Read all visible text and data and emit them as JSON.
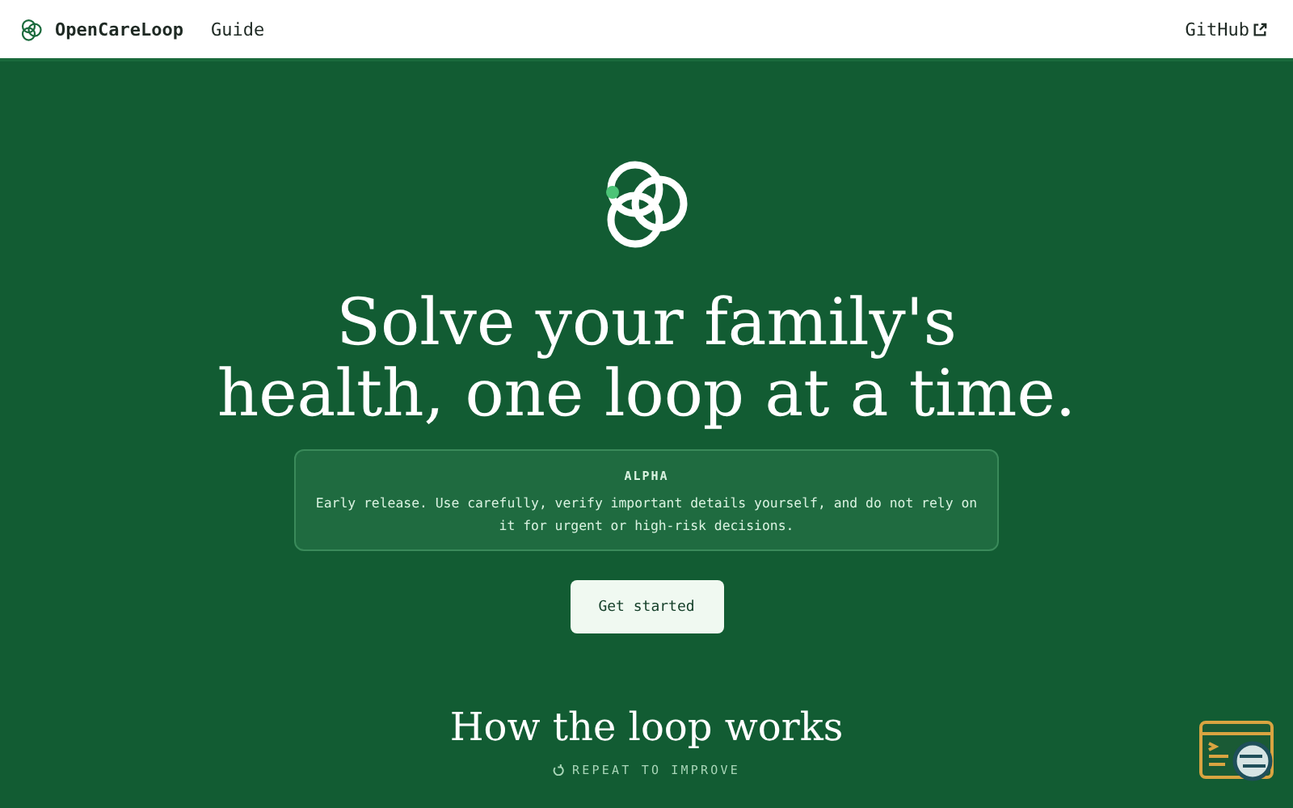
{
  "header": {
    "brand": "OpenCareLoop",
    "nav": [
      {
        "label": "Guide"
      }
    ],
    "github": "GitHub"
  },
  "hero": {
    "headline_lines": [
      "Solve your family's",
      "health, one loop at a time."
    ],
    "notice": {
      "badge": "ALPHA",
      "text": "Early release. Use carefully, verify important details yourself, and do not rely on it for urgent or high-risk decisions."
    },
    "cta": "Get started"
  },
  "section": {
    "title": "How the loop works",
    "subtitle": "REPEAT TO IMPROVE"
  }
}
